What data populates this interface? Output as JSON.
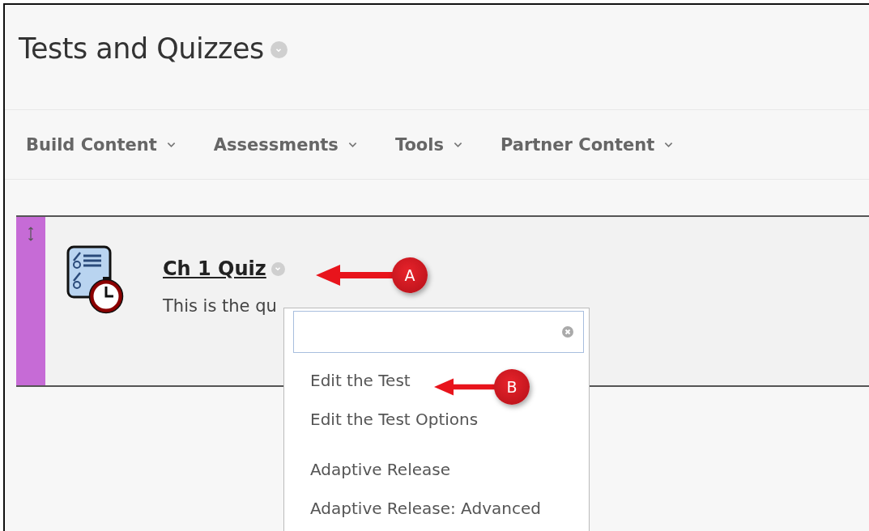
{
  "page": {
    "title": "Tests and Quizzes"
  },
  "nav": [
    {
      "label": "Build Content"
    },
    {
      "label": "Assessments"
    },
    {
      "label": "Tools"
    },
    {
      "label": "Partner Content"
    }
  ],
  "item": {
    "title": "Ch 1 Quiz",
    "description": "This is the qu"
  },
  "menu": {
    "groups": [
      [
        {
          "label": "Edit the Test"
        },
        {
          "label": "Edit the Test Options"
        }
      ],
      [
        {
          "label": "Adaptive Release"
        },
        {
          "label": "Adaptive Release: Advanced"
        }
      ]
    ]
  },
  "callouts": [
    {
      "label": "A"
    },
    {
      "label": "B"
    }
  ]
}
